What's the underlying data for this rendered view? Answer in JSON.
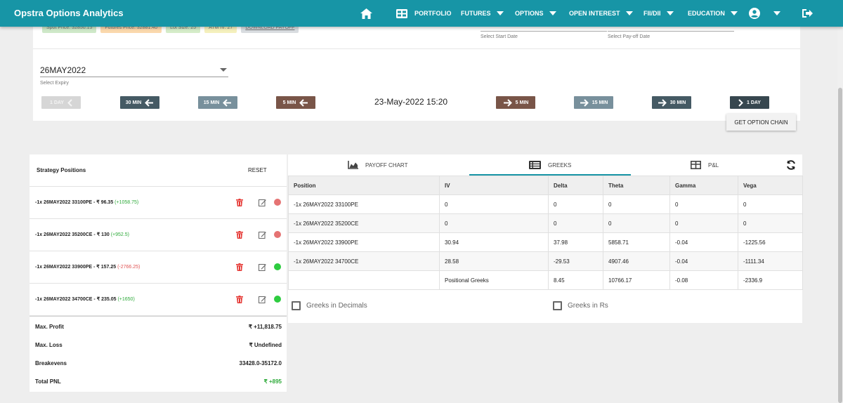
{
  "app": {
    "title": "Opstra Options Analytics"
  },
  "nav": {
    "portfolio": "PORTFOLIO",
    "futures": "FUTURES",
    "options": "OPTIONS",
    "open_interest": "OPEN INTEREST",
    "fii_dii": "FII/DII",
    "education": "EDUCATION"
  },
  "filters": {
    "chips": [
      "Spot Price: 32850.15",
      "Futures Price: 32881.40",
      "Lot Size: 25",
      "ATM IV: 27",
      "DOWNLOAD PAYOFF"
    ],
    "start_date_hint": "Select Start Date",
    "payoff_date_hint": "Select Pay-off Date",
    "expiry_value": "26MAY2022",
    "expiry_hint": "Select Expiry",
    "timestamp": "23-May-2022 15:20",
    "back_buttons": [
      "1 DAY",
      "30 MIN",
      "15 MIN",
      "5 MIN"
    ],
    "fwd_buttons": [
      "5 MIN",
      "15 MIN",
      "30 MIN",
      "1 DAY"
    ],
    "get_chain": "GET OPTION CHAIN"
  },
  "colors": {
    "nav": "#1795a6",
    "btn_disabled": "#d6d6d6",
    "btn_30": "#455a64",
    "btn_15": "#78909c",
    "btn_5": "#795548",
    "profit": "#2eaa3a",
    "loss": "#e05252"
  },
  "strategy": {
    "title": "Strategy Positions",
    "reset": "RESET",
    "positions": [
      {
        "text": "-1x  26MAY2022  33100PE  - ₹ 96.35",
        "pnl": "(+1058.75)",
        "positive": true,
        "status_color": "#e57373"
      },
      {
        "text": "-1x  26MAY2022  35200CE  - ₹ 130",
        "pnl": "(+952.5)",
        "positive": true,
        "status_color": "#e57373"
      },
      {
        "text": "-1x  26MAY2022  33900PE  - ₹ 157.25",
        "pnl": "(-2766.25)",
        "positive": false,
        "status_color": "#2ecc40"
      },
      {
        "text": "-1x  26MAY2022  34700CE  - ₹ 235.05",
        "pnl": "(+1650)",
        "positive": true,
        "status_color": "#2ecc40"
      }
    ],
    "summary": [
      {
        "label": "Max. Profit",
        "value": "₹ +11,818.75"
      },
      {
        "label": "Max. Loss",
        "value": "₹ Undefined"
      },
      {
        "label": "Breakevens",
        "value": "33428.0-35172.0"
      },
      {
        "label": "Total PNL",
        "value": "₹ +895"
      }
    ]
  },
  "tabs": [
    "PAYOFF CHART",
    "GREEKS",
    "P&L"
  ],
  "greeks": {
    "columns": [
      "Position",
      "IV",
      "Delta",
      "Theta",
      "Gamma",
      "Vega"
    ],
    "rows": [
      [
        "-1x 26MAY2022 33100PE",
        "0",
        "0",
        "0",
        "0",
        "0"
      ],
      [
        "-1x 26MAY2022 35200CE",
        "0",
        "0",
        "0",
        "0",
        "0"
      ],
      [
        "-1x 26MAY2022 33900PE",
        "30.94",
        "37.98",
        "5858.71",
        "-0.04",
        "-1225.56"
      ],
      [
        "-1x 26MAY2022 34700CE",
        "28.58",
        "-29.53",
        "4907.46",
        "-0.04",
        "-1111.34"
      ],
      [
        "",
        "Positional Greeks",
        "8.45",
        "10766.17",
        "-0.08",
        "-2336.9"
      ]
    ],
    "decimals_label": "Greeks in Decimals",
    "rupees_label": "Greeks in Rs"
  }
}
